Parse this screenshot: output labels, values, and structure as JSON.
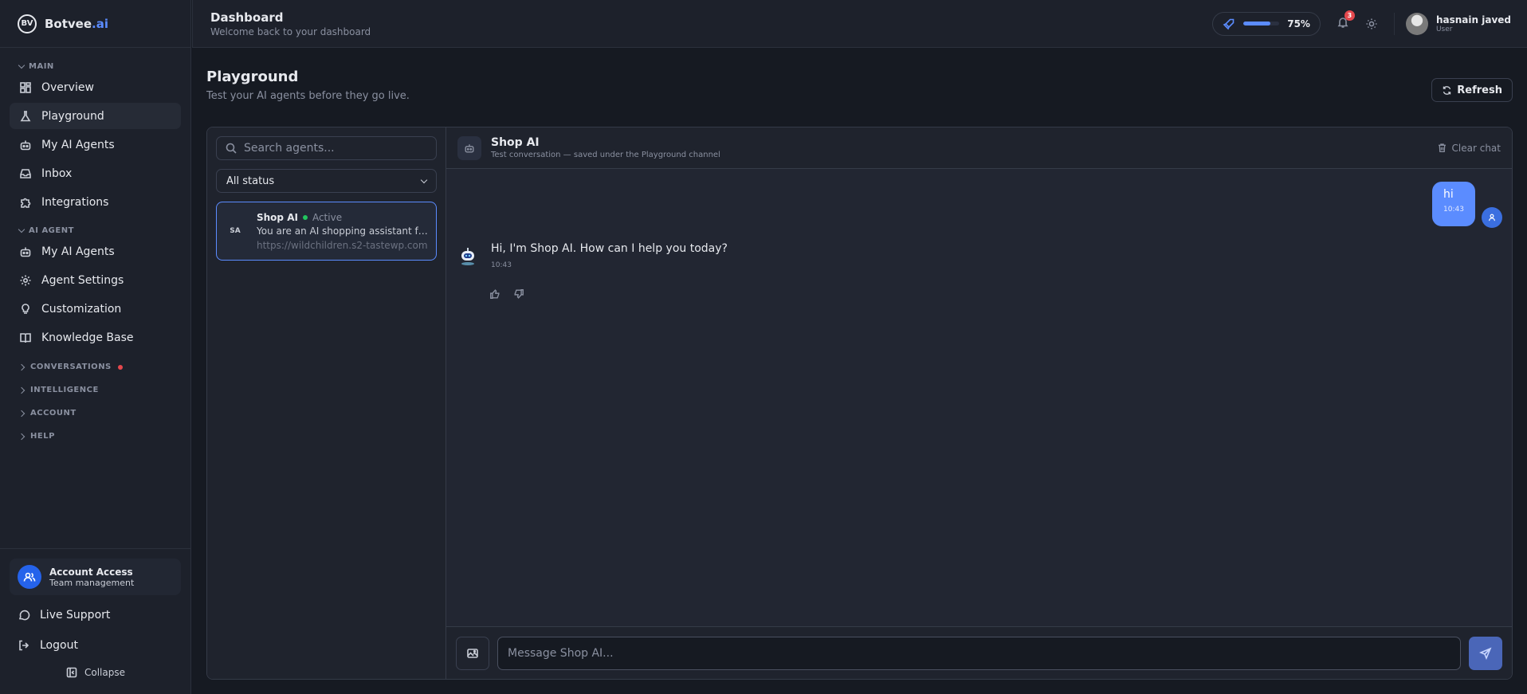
{
  "brand": {
    "name": "Botvee",
    "suffix": ".ai",
    "logo_text": "BV"
  },
  "sidebar": {
    "main_label": "MAIN",
    "main_items": [
      {
        "label": "Overview",
        "icon": "grid-icon"
      },
      {
        "label": "Playground",
        "icon": "flask-icon",
        "active": true
      },
      {
        "label": "My AI Agents",
        "icon": "bot-icon"
      },
      {
        "label": "Inbox",
        "icon": "inbox-icon"
      },
      {
        "label": "Integrations",
        "icon": "puzzle-icon"
      }
    ],
    "agent_label": "AI AGENT",
    "agent_items": [
      {
        "label": "My AI Agents",
        "icon": "bot-icon"
      },
      {
        "label": "Agent Settings",
        "icon": "gear-icon"
      },
      {
        "label": "Customization",
        "icon": "bulb-icon"
      },
      {
        "label": "Knowledge Base",
        "icon": "book-icon"
      }
    ],
    "collapsed_sections": [
      "CONVERSATIONS",
      "INTELLIGENCE",
      "ACCOUNT",
      "HELP"
    ],
    "account": {
      "title": "Account Access",
      "subtitle": "Team management"
    },
    "live_support": "Live Support",
    "logout": "Logout",
    "collapse": "Collapse"
  },
  "header": {
    "title": "Dashboard",
    "subtitle": "Welcome back to your dashboard",
    "progress_percent": 75,
    "progress_label": "75%",
    "notifications": "3",
    "user_name": "hasnain javed",
    "user_role": "User"
  },
  "page": {
    "title": "Playground",
    "subtitle": "Test your AI agents before they go live.",
    "refresh": "Refresh"
  },
  "agents_panel": {
    "search_placeholder": "Search agents...",
    "status_filter": "All status",
    "agents": [
      {
        "initials": "SA",
        "name": "Shop AI",
        "status": "Active",
        "description": "You are an AI shopping assistant for WildChildren",
        "url": "https://wildchildren.s2-tastewp.com"
      }
    ]
  },
  "chat": {
    "title": "Shop AI",
    "subtitle": "Test conversation — saved under the Playground channel",
    "clear": "Clear chat",
    "messages": [
      {
        "from": "user",
        "text": "hi",
        "time": "10:43"
      },
      {
        "from": "bot",
        "text": "Hi, I'm Shop AI. How can I help you today?",
        "time": "10:43"
      }
    ],
    "input_placeholder": "Message Shop AI..."
  },
  "colors": {
    "accent": "#5b8cff",
    "danger": "#e5484d",
    "success": "#22c55e",
    "background": "#161a22",
    "surface": "#1d212b"
  }
}
